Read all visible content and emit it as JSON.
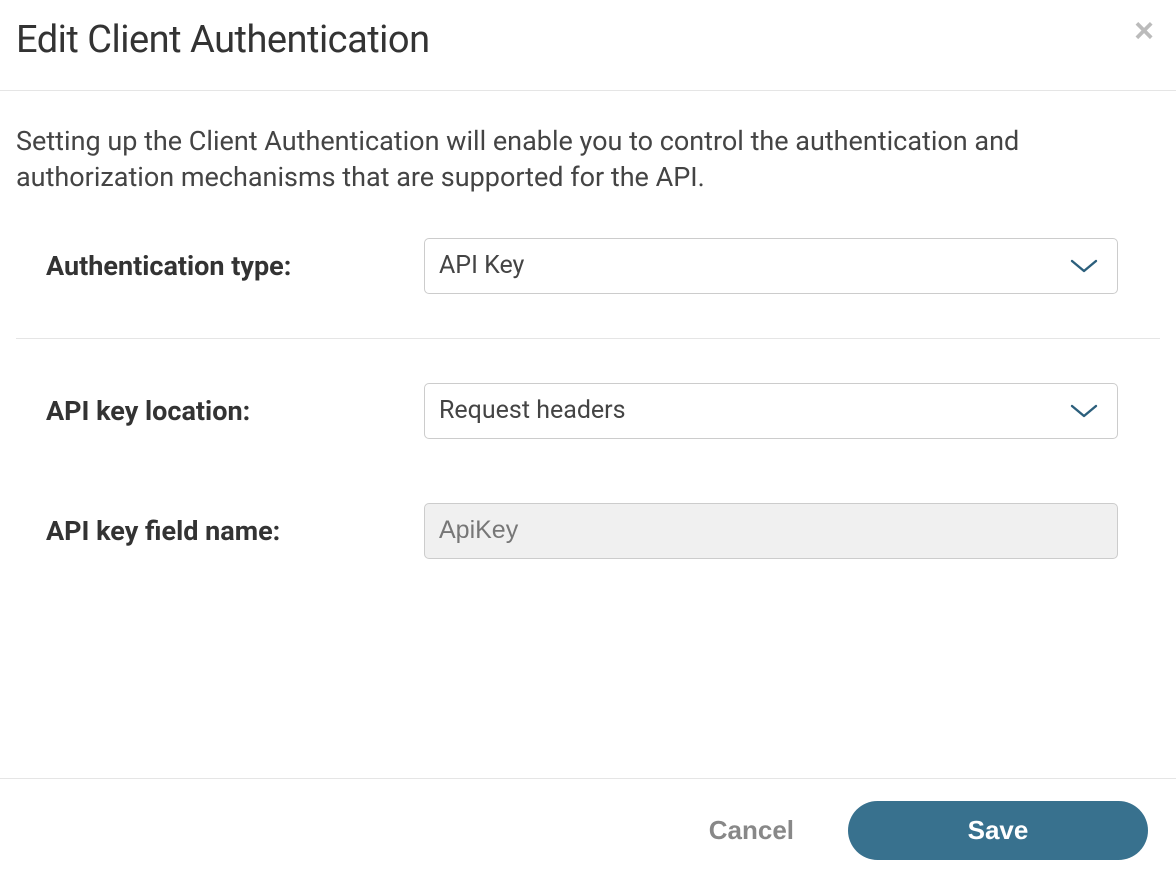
{
  "modal": {
    "title": "Edit Client Authentication",
    "description": "Setting up the Client Authentication will enable you to control the authentication and authorization mechanisms that are supported for the API."
  },
  "form": {
    "auth_type": {
      "label": "Authentication type:",
      "value": "API Key"
    },
    "api_key_location": {
      "label": "API key location:",
      "value": "Request headers"
    },
    "api_key_field_name": {
      "label": "API key field name:",
      "value": "ApiKey"
    }
  },
  "footer": {
    "cancel_label": "Cancel",
    "save_label": "Save"
  },
  "colors": {
    "primary": "#38718e",
    "chevron": "#2c5f7c"
  }
}
